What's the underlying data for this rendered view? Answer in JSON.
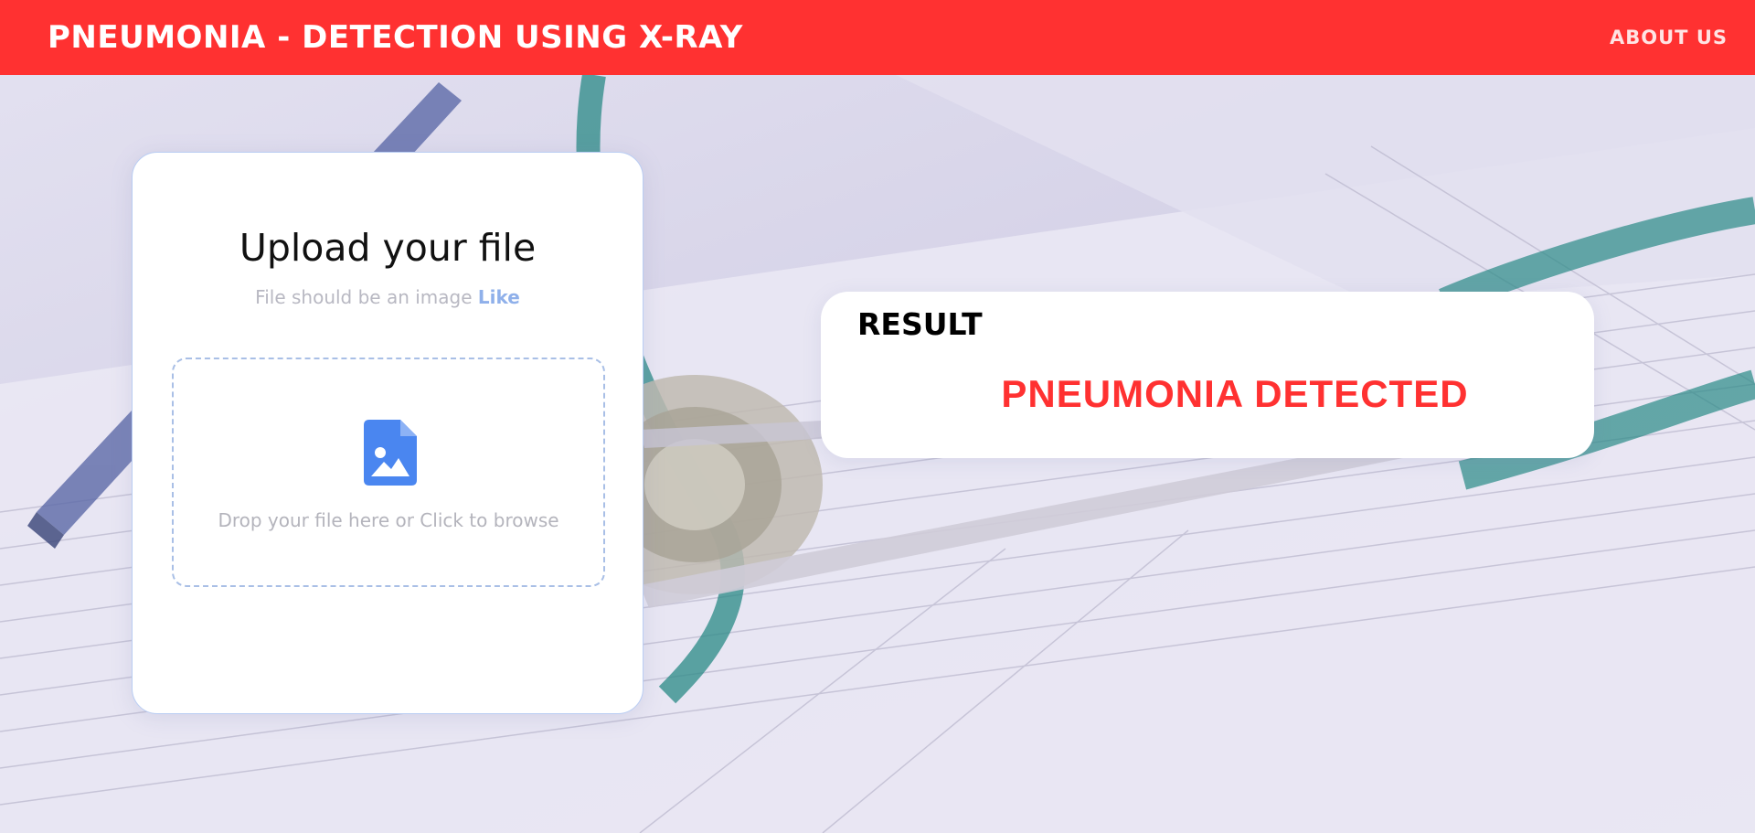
{
  "header": {
    "title": "PNEUMONIA - DETECTION USING X-RAY",
    "about_label": "ABOUT US"
  },
  "upload": {
    "title": "Upload your file",
    "subtitle": "File should be an image",
    "subtitle_link": "Like",
    "drop_text": "Drop your file here or Click to browse",
    "icon": "image-file-icon"
  },
  "result": {
    "heading": "RESULT",
    "value": "PNEUMONIA DETECTED"
  },
  "colors": {
    "brand_red": "#ff3131",
    "accent_blue": "#4a86f0",
    "card_bg": "#ffffff"
  }
}
